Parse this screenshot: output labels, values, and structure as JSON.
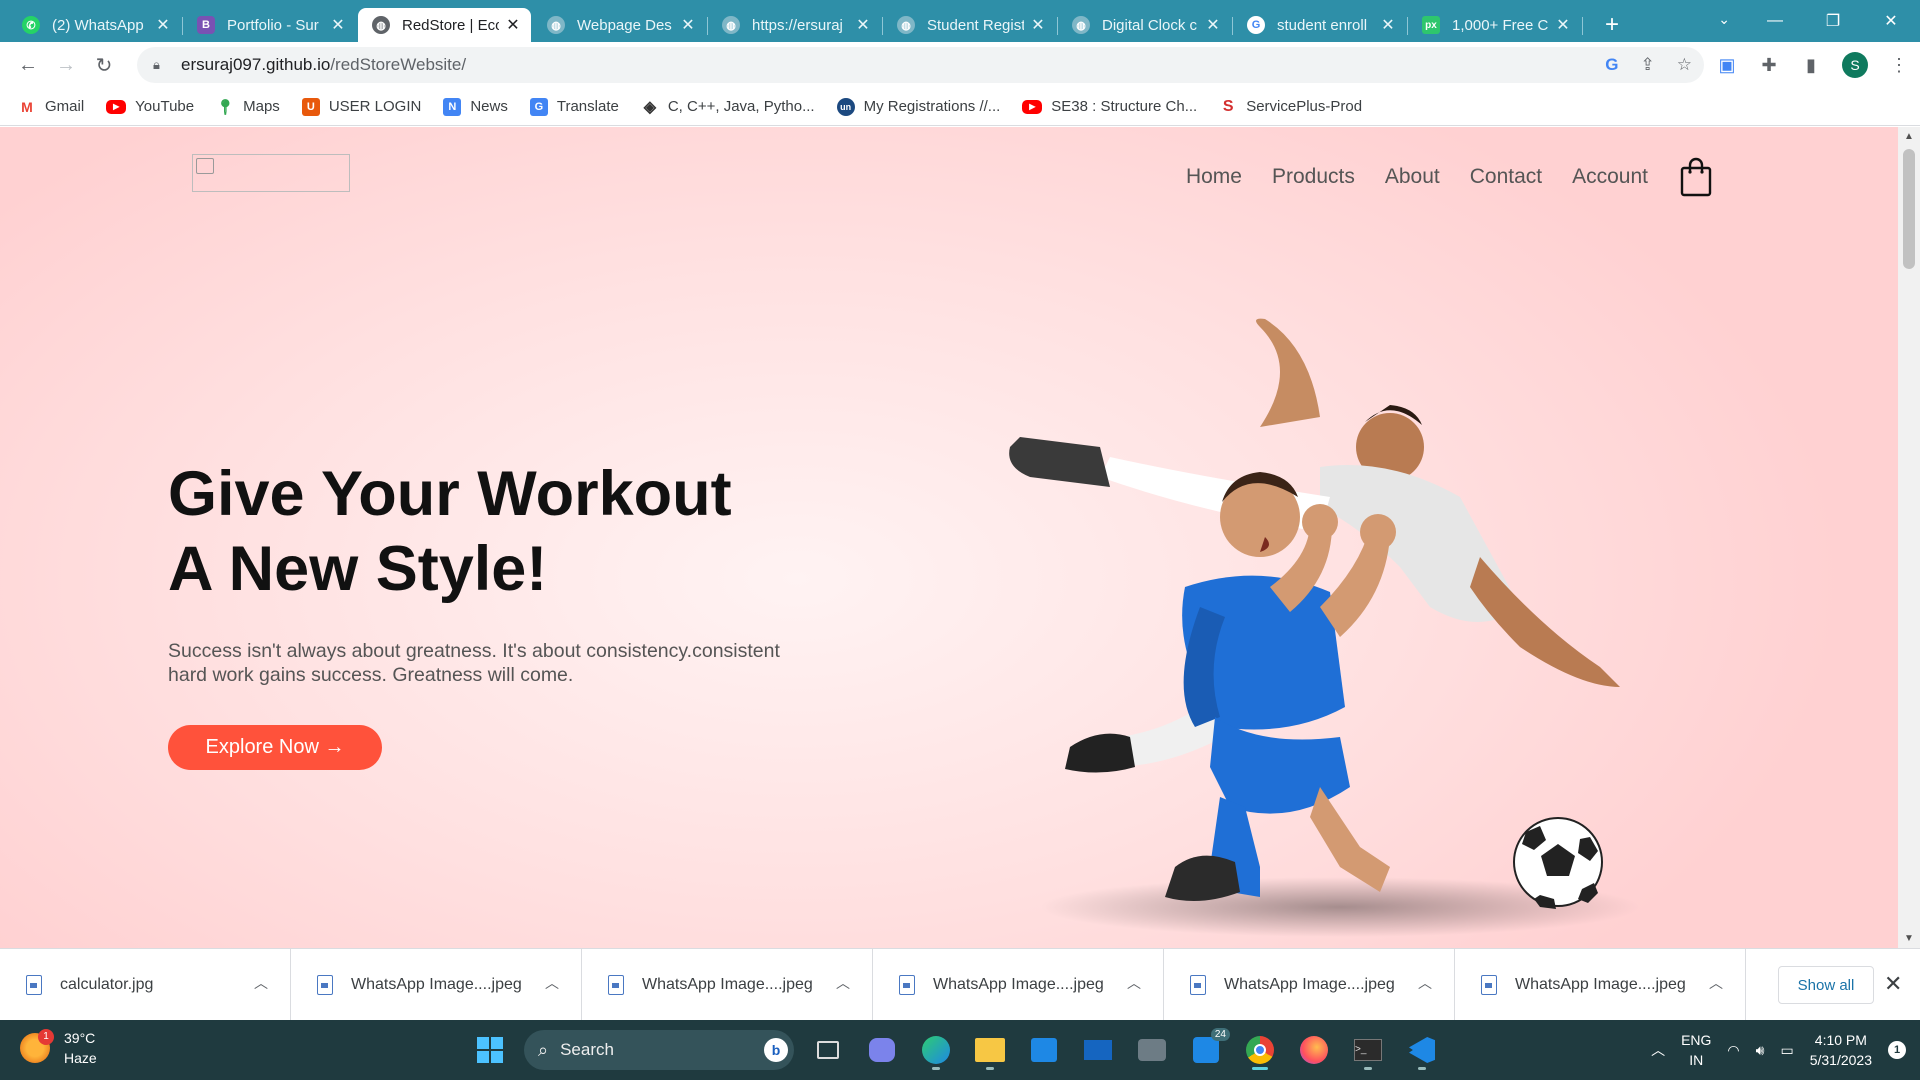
{
  "browser": {
    "tabs": [
      {
        "title": "(2) WhatsApp",
        "favicon": "whatsapp-icon",
        "color": "#25d366",
        "active": false
      },
      {
        "title": "Portfolio - Sur",
        "favicon": "bootstrap-icon",
        "color": "#7952b3",
        "active": false
      },
      {
        "title": "RedStore | Eco",
        "favicon": "globe-icon",
        "color": "#5f6368",
        "active": true
      },
      {
        "title": "Webpage Des",
        "favicon": "globe-icon",
        "color": "#9fc8d3",
        "active": false
      },
      {
        "title": "https://ersuraj",
        "favicon": "globe-icon",
        "color": "#9fc8d3",
        "active": false
      },
      {
        "title": "Student Regist",
        "favicon": "globe-icon",
        "color": "#9fc8d3",
        "active": false
      },
      {
        "title": "Digital Clock c",
        "favicon": "globe-icon",
        "color": "#9fc8d3",
        "active": false
      },
      {
        "title": "student enroll",
        "favicon": "google-icon",
        "color": "#4285f4",
        "active": false
      },
      {
        "title": "1,000+ Free C",
        "favicon": "pixabay-icon",
        "color": "#2ec66d",
        "active": false
      }
    ],
    "url_host": "ersuraj097.github.io",
    "url_path": "/redStoreWebsite/",
    "bookmarks": [
      {
        "label": "Gmail",
        "icon": "gmail-icon",
        "color": "#ea4335"
      },
      {
        "label": "YouTube",
        "icon": "youtube-icon",
        "color": "#ff0000"
      },
      {
        "label": "Maps",
        "icon": "maps-icon",
        "color": "#34a853"
      },
      {
        "label": "USER LOGIN",
        "icon": "user-login-icon",
        "color": "#e8590c"
      },
      {
        "label": "News",
        "icon": "news-icon",
        "color": "#4285f4"
      },
      {
        "label": "Translate",
        "icon": "translate-icon",
        "color": "#4285f4"
      },
      {
        "label": "C, C++, Java, Pytho...",
        "icon": "code-icon",
        "color": "#333333"
      },
      {
        "label": "My Registrations //...",
        "icon": "unstop-icon",
        "color": "#1c4980"
      },
      {
        "label": "SE38 : Structure Ch...",
        "icon": "youtube-icon",
        "color": "#ff0000"
      },
      {
        "label": "ServicePlus-Prod",
        "icon": "serviceplus-icon",
        "color": "#d32f2f"
      }
    ]
  },
  "site": {
    "nav": [
      "Home",
      "Products",
      "About",
      "Contact",
      "Account"
    ],
    "hero_title_line1": "Give Your Workout",
    "hero_title_line2": "A New Style!",
    "hero_subtitle": "Success isn't always about greatness. It's about consistency.consistent hard work gains success. Greatness will come.",
    "cta_label": "Explore Now →",
    "accent_color": "#ff523b"
  },
  "downloads": {
    "items": [
      "calculator.jpg",
      "WhatsApp Image....jpeg",
      "WhatsApp Image....jpeg",
      "WhatsApp Image....jpeg",
      "WhatsApp Image....jpeg",
      "WhatsApp Image....jpeg"
    ],
    "show_all": "Show all"
  },
  "taskbar": {
    "temperature": "39°C",
    "weather": "Haze",
    "weather_badge": "1",
    "search_placeholder": "Search",
    "store_badge": "24",
    "lang_line1": "ENG",
    "lang_line2": "IN",
    "time": "4:10 PM",
    "date": "5/31/2023",
    "notification_count": "1"
  }
}
